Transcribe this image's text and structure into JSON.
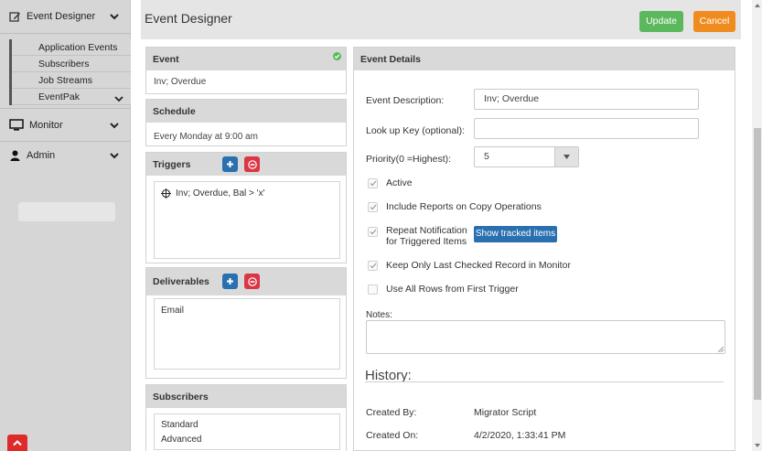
{
  "sidebar": {
    "event_designer_label": "Event Designer",
    "sub_items": [
      {
        "label": "Application Events"
      },
      {
        "label": "Subscribers"
      },
      {
        "label": "Job Streams"
      },
      {
        "label": "EventPak"
      }
    ],
    "monitor_label": "Monitor",
    "admin_label": "Admin"
  },
  "header": {
    "title": "Event Designer",
    "update_label": "Update",
    "cancel_label": "Cancel"
  },
  "event_panel": {
    "title": "Event",
    "value": "Inv; Overdue"
  },
  "schedule_panel": {
    "title": "Schedule",
    "value": "Every Monday at 9:00 am"
  },
  "triggers_panel": {
    "title": "Triggers",
    "items": [
      "Inv; Overdue, Bal > 'x'"
    ]
  },
  "deliverables_panel": {
    "title": "Deliverables",
    "items": [
      "Email"
    ]
  },
  "subscribers_panel": {
    "title": "Subscribers",
    "items": [
      "Standard",
      "Advanced"
    ]
  },
  "details": {
    "title": "Event Details",
    "description_label": "Event Description:",
    "description_value": "Inv; Overdue",
    "lookup_label": "Look up Key (optional):",
    "lookup_value": "",
    "priority_label": "Priority(0 =Highest):",
    "priority_value": "5",
    "active_label": "Active",
    "include_reports_label": "Include Reports on Copy Operations",
    "repeat_label_line1": "Repeat Notification",
    "repeat_label_line2": "for Triggered Items",
    "show_tracked_label": "Show tracked items",
    "keep_last_label": "Keep Only Last Checked Record in Monitor",
    "use_all_rows_label": "Use All Rows from First Trigger",
    "notes_label": "Notes:",
    "notes_value": "",
    "history_title": "History:",
    "created_by_label": "Created By:",
    "created_by_value": "Migrator Script",
    "created_on_label": "Created On:",
    "created_on_value": "4/2/2020, 1:33:41 PM"
  },
  "colors": {
    "update_green": "#5cb85c",
    "cancel_orange": "#f08c1f",
    "primary_blue": "#2a6fb0",
    "danger_red": "#dc3545"
  }
}
